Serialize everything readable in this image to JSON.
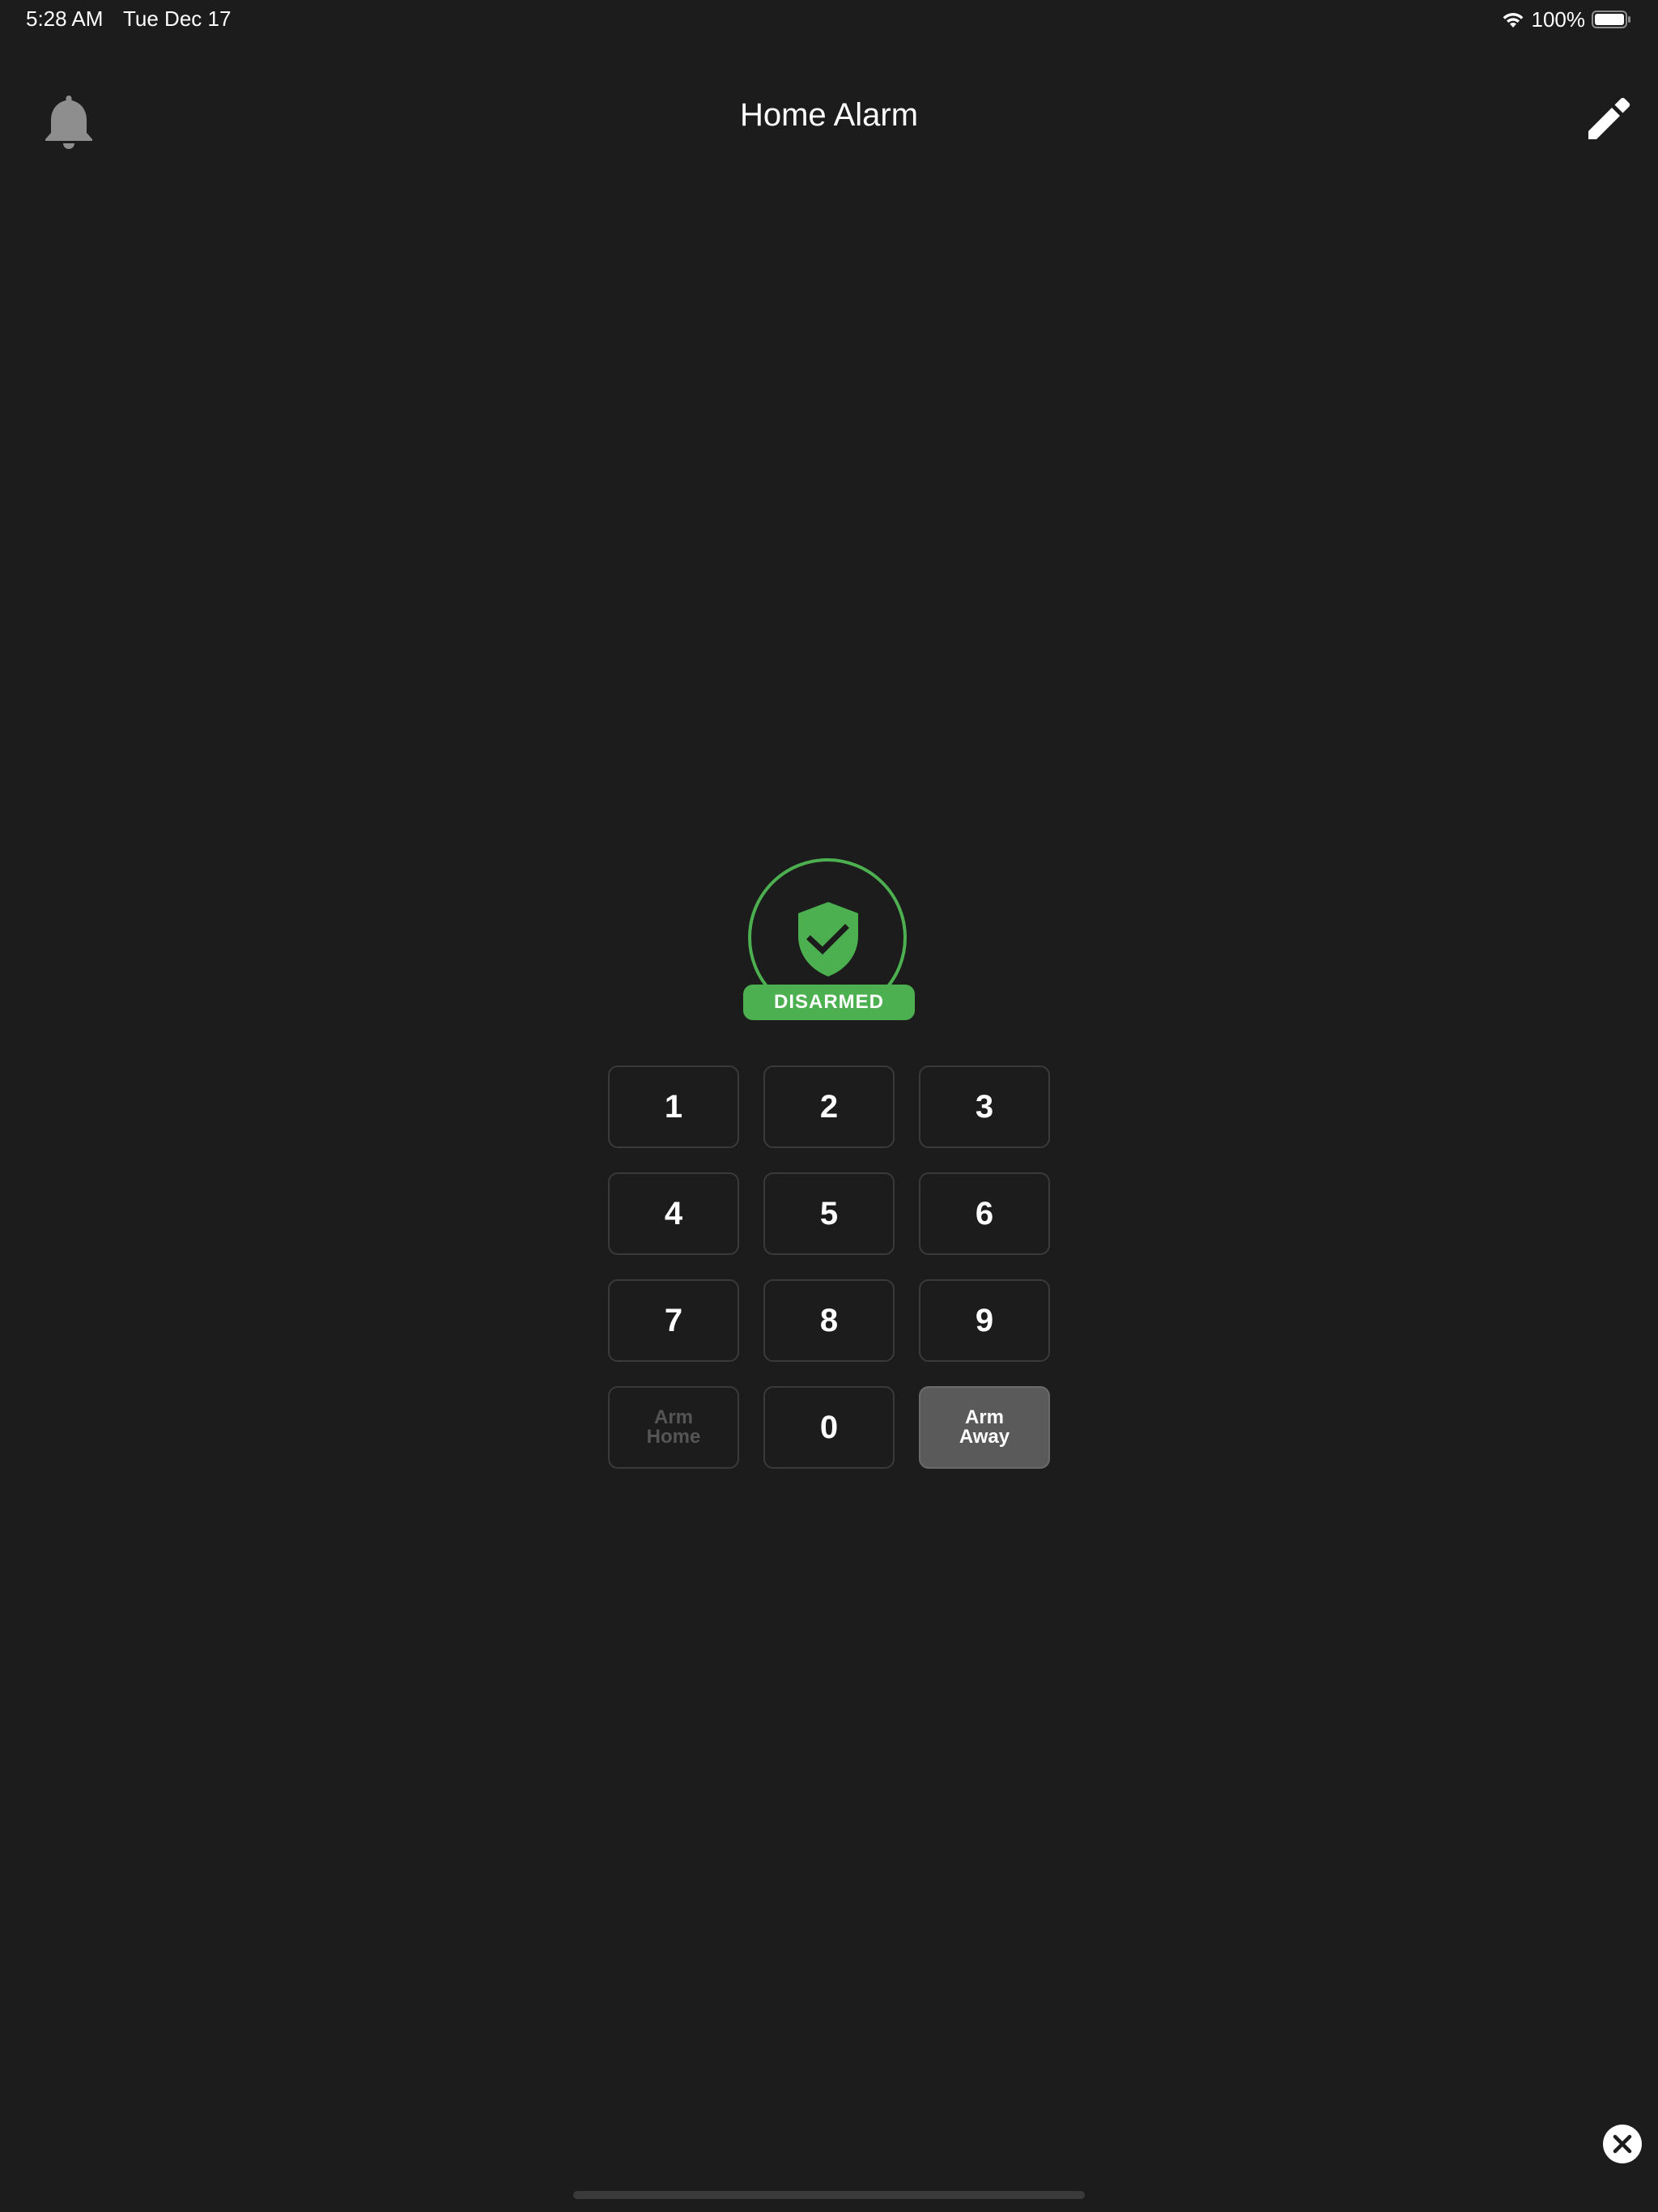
{
  "status_bar": {
    "time": "5:28 AM",
    "date": "Tue Dec 17",
    "battery": "100%",
    "icons": [
      "wifi-icon",
      "battery-icon"
    ]
  },
  "header": {
    "title": "Home Alarm",
    "left_icon": "bell-icon",
    "right_icon": "pencil-icon"
  },
  "alarm": {
    "state": "DISARMED",
    "state_icon": "shield-check-icon",
    "state_color": "#4caf50"
  },
  "keypad": {
    "keys": [
      "1",
      "2",
      "3",
      "4",
      "5",
      "6",
      "7",
      "8",
      "9"
    ],
    "arm_home": {
      "line1": "Arm",
      "line2": "Home",
      "enabled": false
    },
    "zero": "0",
    "arm_away": {
      "line1": "Arm",
      "line2": "Away",
      "enabled": true
    }
  },
  "colors": {
    "background": "#1c1c1c",
    "accent": "#4caf50",
    "key_border": "#3a3a3a",
    "active_key": "#5a5a5a"
  },
  "footer": {
    "close_icon": "close-icon"
  }
}
